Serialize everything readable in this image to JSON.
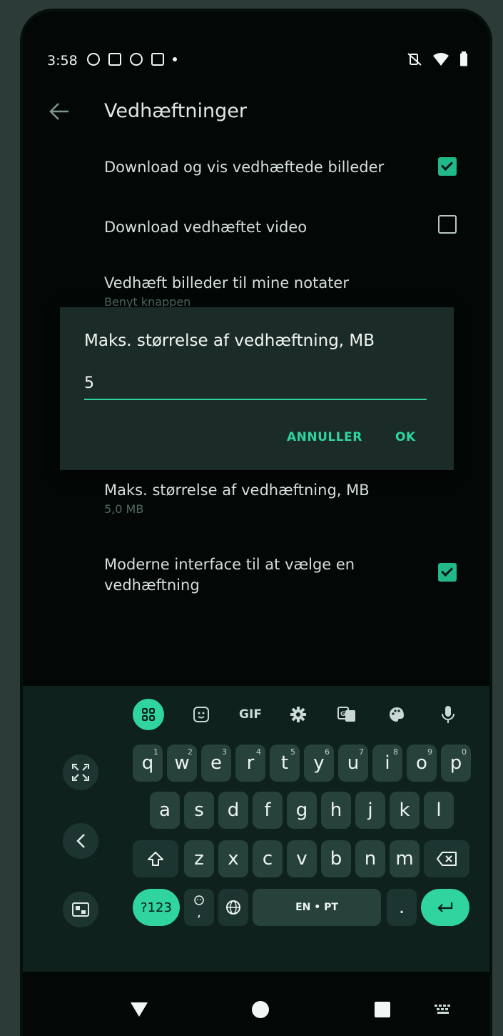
{
  "status_bar": {
    "time": "3:58"
  },
  "app_bar": {
    "title": "Vedhæftninger"
  },
  "preferences": [
    {
      "title": "Download og vis vedhæftede billeder",
      "subtitle": "",
      "checked": true
    },
    {
      "title": "Download vedhæftet video",
      "subtitle": "",
      "checked": false
    },
    {
      "title": "Vedhæft billeder til mine notater",
      "subtitle": "Benyt knappen"
    },
    {
      "title": "Maks. størrelse af vedhæftning, MB",
      "subtitle": "5,0 MB"
    },
    {
      "title": "Moderne interface til at vælge en vedhæftning",
      "subtitle": "",
      "checked": true
    }
  ],
  "dialog": {
    "title": "Maks. størrelse af vedhæftning, MB",
    "value": "5",
    "cancel_label": "ANNULLER",
    "ok_label": "OK"
  },
  "keyboard": {
    "toolbar": {
      "gif_label": "GIF",
      "icons": [
        "apps-icon",
        "sticker-icon",
        "gif",
        "settings-icon",
        "translate-icon",
        "palette-icon",
        "microphone-icon"
      ]
    },
    "row1": [
      {
        "key": "q",
        "hint": "1"
      },
      {
        "key": "w",
        "hint": "2"
      },
      {
        "key": "e",
        "hint": "3"
      },
      {
        "key": "r",
        "hint": "4"
      },
      {
        "key": "t",
        "hint": "5"
      },
      {
        "key": "y",
        "hint": "6"
      },
      {
        "key": "u",
        "hint": "7"
      },
      {
        "key": "i",
        "hint": "8"
      },
      {
        "key": "o",
        "hint": "9"
      },
      {
        "key": "p",
        "hint": "0"
      }
    ],
    "row2": [
      "a",
      "s",
      "d",
      "f",
      "g",
      "h",
      "j",
      "k",
      "l"
    ],
    "row3": [
      "z",
      "x",
      "c",
      "v",
      "b",
      "n",
      "m"
    ],
    "symbols_label": "?123",
    "emoji_comma_label": ",",
    "space_label": "EN • PT",
    "period_label": "."
  },
  "colors": {
    "accent": "#2fd49e",
    "background": "#030806",
    "dialog": "#1b2b27",
    "keyboard": "#0f211d"
  }
}
